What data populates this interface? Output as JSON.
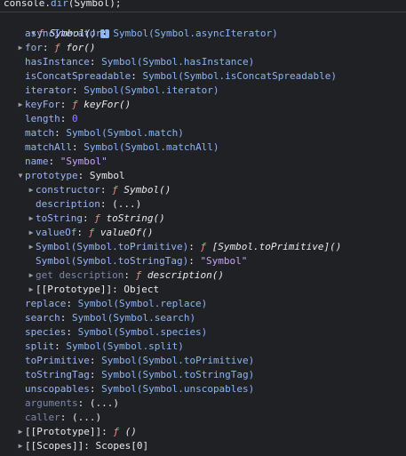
{
  "command": {
    "prefix": "console.",
    "method": "dir",
    "args": "(Symbol);"
  },
  "root": {
    "fn_keyword": "ƒ",
    "name": "Symbol()",
    "info_icon": "info-icon",
    "info_glyph": "i"
  },
  "rows": [
    {
      "indent": 1,
      "toggle": "",
      "key": "asyncIterator",
      "key_style": "key",
      "sep": ": ",
      "parts": [
        {
          "t": "Symbol(Symbol.asyncIterator)",
          "c": "str"
        }
      ]
    },
    {
      "indent": 1,
      "toggle": "collapsed",
      "key": "for",
      "key_style": "key",
      "sep": ": ",
      "parts": [
        {
          "t": "ƒ ",
          "c": "fn-kw"
        },
        {
          "t": "for()",
          "c": "fn-name"
        }
      ]
    },
    {
      "indent": 1,
      "toggle": "",
      "key": "hasInstance",
      "key_style": "key",
      "sep": ": ",
      "parts": [
        {
          "t": "Symbol(Symbol.hasInstance)",
          "c": "str"
        }
      ]
    },
    {
      "indent": 1,
      "toggle": "",
      "key": "isConcatSpreadable",
      "key_style": "key",
      "sep": ": ",
      "parts": [
        {
          "t": "Symbol(Symbol.isConcatSpreadable)",
          "c": "str"
        }
      ]
    },
    {
      "indent": 1,
      "toggle": "",
      "key": "iterator",
      "key_style": "key",
      "sep": ": ",
      "parts": [
        {
          "t": "Symbol(Symbol.iterator)",
          "c": "str"
        }
      ]
    },
    {
      "indent": 1,
      "toggle": "collapsed",
      "key": "keyFor",
      "key_style": "key",
      "sep": ": ",
      "parts": [
        {
          "t": "ƒ ",
          "c": "fn-kw"
        },
        {
          "t": "keyFor()",
          "c": "fn-name"
        }
      ]
    },
    {
      "indent": 1,
      "toggle": "",
      "key": "length",
      "key_style": "key",
      "sep": ": ",
      "parts": [
        {
          "t": "0",
          "c": "num"
        }
      ]
    },
    {
      "indent": 1,
      "toggle": "",
      "key": "match",
      "key_style": "key",
      "sep": ": ",
      "parts": [
        {
          "t": "Symbol(Symbol.match)",
          "c": "str"
        }
      ]
    },
    {
      "indent": 1,
      "toggle": "",
      "key": "matchAll",
      "key_style": "key",
      "sep": ": ",
      "parts": [
        {
          "t": "Symbol(Symbol.matchAll)",
          "c": "str"
        }
      ]
    },
    {
      "indent": 1,
      "toggle": "",
      "key": "name",
      "key_style": "key",
      "sep": ": ",
      "parts": [
        {
          "t": "\"Symbol\"",
          "c": "str-lit"
        }
      ]
    },
    {
      "indent": 1,
      "toggle": "expanded",
      "key": "prototype",
      "key_style": "key",
      "sep": ": ",
      "parts": [
        {
          "t": "Symbol",
          "c": "plain"
        }
      ]
    },
    {
      "indent": 2,
      "toggle": "collapsed",
      "key": "constructor",
      "key_style": "key",
      "sep": ": ",
      "parts": [
        {
          "t": "ƒ ",
          "c": "fn-kw"
        },
        {
          "t": "Symbol()",
          "c": "fn-name"
        }
      ]
    },
    {
      "indent": 2,
      "toggle": "",
      "key": "description",
      "key_style": "key",
      "sep": ": ",
      "parts": [
        {
          "t": "(...)",
          "c": "plain"
        }
      ]
    },
    {
      "indent": 2,
      "toggle": "collapsed",
      "key": "toString",
      "key_style": "key",
      "sep": ": ",
      "parts": [
        {
          "t": "ƒ ",
          "c": "fn-kw"
        },
        {
          "t": "toString()",
          "c": "fn-name"
        }
      ]
    },
    {
      "indent": 2,
      "toggle": "collapsed",
      "key": "valueOf",
      "key_style": "key",
      "sep": ": ",
      "parts": [
        {
          "t": "ƒ ",
          "c": "fn-kw"
        },
        {
          "t": "valueOf()",
          "c": "fn-name"
        }
      ]
    },
    {
      "indent": 2,
      "toggle": "collapsed",
      "key": "Symbol(Symbol.toPrimitive)",
      "key_style": "key",
      "sep": ": ",
      "parts": [
        {
          "t": "ƒ ",
          "c": "fn-kw"
        },
        {
          "t": "[Symbol.toPrimitive]()",
          "c": "fn-name"
        }
      ]
    },
    {
      "indent": 2,
      "toggle": "",
      "key": "Symbol(Symbol.toStringTag)",
      "key_style": "key",
      "sep": ": ",
      "parts": [
        {
          "t": "\"Symbol\"",
          "c": "str-lit"
        }
      ]
    },
    {
      "indent": 2,
      "toggle": "collapsed",
      "key": "get description",
      "key_style": "key-dim",
      "sep": ": ",
      "parts": [
        {
          "t": "ƒ ",
          "c": "fn-kw"
        },
        {
          "t": "description()",
          "c": "fn-name"
        }
      ]
    },
    {
      "indent": 2,
      "toggle": "collapsed",
      "key": "[[Prototype]]",
      "key_style": "key-proto",
      "sep": ": ",
      "parts": [
        {
          "t": "Object",
          "c": "plain"
        }
      ]
    },
    {
      "indent": 1,
      "toggle": "",
      "key": "replace",
      "key_style": "key",
      "sep": ": ",
      "parts": [
        {
          "t": "Symbol(Symbol.replace)",
          "c": "str"
        }
      ]
    },
    {
      "indent": 1,
      "toggle": "",
      "key": "search",
      "key_style": "key",
      "sep": ": ",
      "parts": [
        {
          "t": "Symbol(Symbol.search)",
          "c": "str"
        }
      ]
    },
    {
      "indent": 1,
      "toggle": "",
      "key": "species",
      "key_style": "key",
      "sep": ": ",
      "parts": [
        {
          "t": "Symbol(Symbol.species)",
          "c": "str"
        }
      ]
    },
    {
      "indent": 1,
      "toggle": "",
      "key": "split",
      "key_style": "key",
      "sep": ": ",
      "parts": [
        {
          "t": "Symbol(Symbol.split)",
          "c": "str"
        }
      ]
    },
    {
      "indent": 1,
      "toggle": "",
      "key": "toPrimitive",
      "key_style": "key",
      "sep": ": ",
      "parts": [
        {
          "t": "Symbol(Symbol.toPrimitive)",
          "c": "str"
        }
      ]
    },
    {
      "indent": 1,
      "toggle": "",
      "key": "toStringTag",
      "key_style": "key",
      "sep": ": ",
      "parts": [
        {
          "t": "Symbol(Symbol.toStringTag)",
          "c": "str"
        }
      ]
    },
    {
      "indent": 1,
      "toggle": "",
      "key": "unscopables",
      "key_style": "key",
      "sep": ": ",
      "parts": [
        {
          "t": "Symbol(Symbol.unscopables)",
          "c": "str"
        }
      ]
    },
    {
      "indent": 1,
      "toggle": "",
      "key": "arguments",
      "key_style": "key-dim",
      "sep": ": ",
      "parts": [
        {
          "t": "(...)",
          "c": "plain"
        }
      ]
    },
    {
      "indent": 1,
      "toggle": "",
      "key": "caller",
      "key_style": "key-dim",
      "sep": ": ",
      "parts": [
        {
          "t": "(...)",
          "c": "plain"
        }
      ]
    },
    {
      "indent": 1,
      "toggle": "collapsed",
      "key": "[[Prototype]]",
      "key_style": "key-proto",
      "sep": ": ",
      "parts": [
        {
          "t": "ƒ ",
          "c": "fn-kw"
        },
        {
          "t": "()",
          "c": "fn-name"
        }
      ]
    },
    {
      "indent": 1,
      "toggle": "collapsed",
      "key": "[[Scopes]]",
      "key_style": "key-proto",
      "sep": ": ",
      "parts": [
        {
          "t": "Scopes[0]",
          "c": "plain"
        }
      ]
    }
  ],
  "colors": {
    "background": "#202124",
    "key": "#9ab4f8",
    "symbol_value": "#8ab4f8",
    "string_literal": "#c5a5f5",
    "number": "#9980ff",
    "function_keyword": "#f28b82"
  },
  "icons": {
    "collapsed": "triangle-right-icon",
    "expanded": "triangle-down-icon"
  }
}
